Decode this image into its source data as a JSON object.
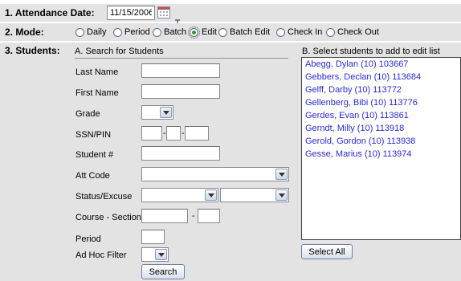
{
  "attendance_date": {
    "label": "1. Attendance Date:",
    "value": "11/15/2006"
  },
  "mode": {
    "label": "2. Mode:",
    "options": [
      "Daily",
      "Period",
      "Batch",
      "Edit",
      "Batch Edit",
      "Check In",
      "Check Out"
    ],
    "selected": "Edit"
  },
  "students": {
    "label": "3. Students:",
    "search_heading": "A. Search for Students",
    "fields": {
      "last_name": "Last Name",
      "first_name": "First Name",
      "grade": "Grade",
      "ssn_pin": "SSN/PIN",
      "student_num": "Student #",
      "att_code": "Att Code",
      "status_excuse": "Status/Excuse",
      "course_section": "Course - Section",
      "period": "Period",
      "ad_hoc_filter": "Ad Hoc Filter"
    },
    "dash": "-",
    "search_button": "Search"
  },
  "select_list": {
    "heading": "B. Select students to add to edit list",
    "items": [
      "Abegg, Dylan (10) 103667",
      "Gebbers, Declan (10) 113684",
      "Gelff, Darby (10) 113772",
      "Gellenberg, Bibi (10) 113776",
      "Gerdes, Evan (10) 113861",
      "Gerndt, Milly (10) 113918",
      "Gerold, Gordon (10) 113938",
      "Gesse, Marius (10) 113974"
    ],
    "select_all_button": "Select All"
  },
  "colors": {
    "link": "#2b2bd4",
    "band": "#e3e3e3",
    "selected_radio": "#2c9a2c"
  },
  "icons": {
    "calendar": "calendar-icon",
    "text_cursor": "text-cursor-icon"
  }
}
